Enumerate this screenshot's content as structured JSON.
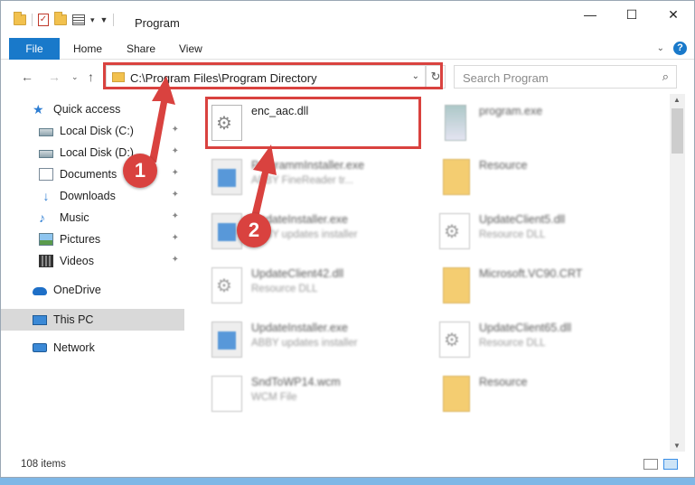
{
  "window": {
    "title": "Program",
    "controls": {
      "minimize": "—",
      "maximize": "☐",
      "close": "✕"
    }
  },
  "ribbon": {
    "tabs": [
      "File",
      "Home",
      "Share",
      "View"
    ]
  },
  "address": {
    "path": "C:\\Program Files\\Program Directory",
    "search_placeholder": "Search Program"
  },
  "sidebar": {
    "items": [
      {
        "label": "Quick access",
        "icon": "star-icon"
      },
      {
        "label": "Local Disk (C:)",
        "icon": "disk-icon",
        "pinned": true
      },
      {
        "label": "Local Disk (D:)",
        "icon": "disk-icon",
        "pinned": true
      },
      {
        "label": "Documents",
        "icon": "documents-icon",
        "pinned": true
      },
      {
        "label": "Downloads",
        "icon": "download-icon",
        "pinned": true
      },
      {
        "label": "Music",
        "icon": "music-icon",
        "pinned": true
      },
      {
        "label": "Pictures",
        "icon": "pictures-icon",
        "pinned": true
      },
      {
        "label": "Videos",
        "icon": "videos-icon",
        "pinned": true
      },
      {
        "label": "OneDrive",
        "icon": "cloud-icon"
      },
      {
        "label": "This PC",
        "icon": "computer-icon",
        "selected": true
      },
      {
        "label": "Network",
        "icon": "network-icon"
      }
    ]
  },
  "files": [
    {
      "name": "enc_aac.dll",
      "desc": "",
      "icon": "dll-icon"
    },
    {
      "name": "program.exe",
      "desc": "",
      "icon": "program-icon"
    },
    {
      "name": "ProgrammInstaller.exe",
      "desc": "ABBY FineReader tr...",
      "icon": "installer-icon"
    },
    {
      "name": "Resource",
      "desc": "",
      "icon": "folder-icon"
    },
    {
      "name": "UpdateInstaller.exe",
      "desc": "ABBY updates installer",
      "icon": "installer-icon"
    },
    {
      "name": "UpdateClient5.dll",
      "desc": "Resource DLL",
      "icon": "dll-icon"
    },
    {
      "name": "UpdateClient42.dll",
      "desc": "Resource DLL",
      "icon": "dll-icon"
    },
    {
      "name": "Microsoft.VC90.CRT",
      "desc": "",
      "icon": "folder-icon"
    },
    {
      "name": "UpdateInstaller.exe",
      "desc": "ABBY updates installer",
      "icon": "installer-icon"
    },
    {
      "name": "UpdateClient65.dll",
      "desc": "Resource DLL",
      "icon": "dll-icon"
    },
    {
      "name": "SndToWP14.wcm",
      "desc": "WCM File",
      "icon": "file-icon"
    },
    {
      "name": "Resource",
      "desc": "",
      "icon": "folder-icon"
    }
  ],
  "annotations": {
    "step1": "1",
    "step2": "2",
    "highlight_color": "#d9423f"
  },
  "status": {
    "item_count": "108 items"
  },
  "colors": {
    "accent": "#1979ca"
  }
}
